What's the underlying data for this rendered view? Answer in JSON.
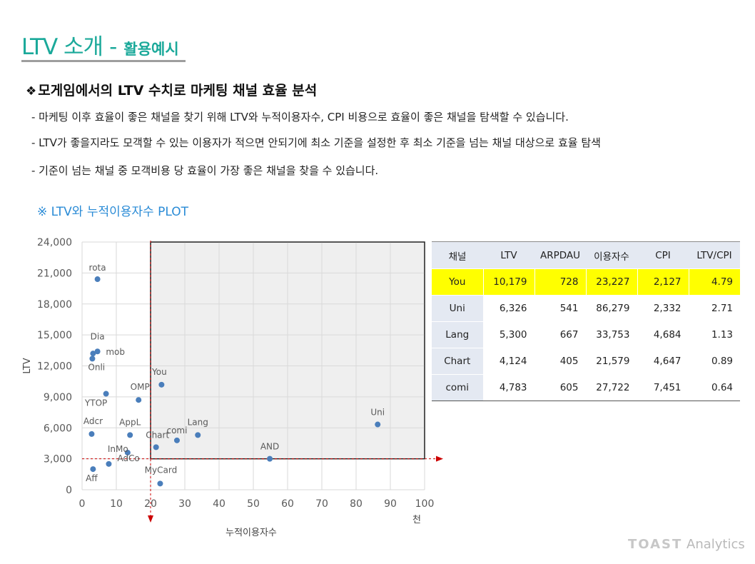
{
  "page": {
    "title_main": "LTV 소개",
    "title_dash": "-",
    "title_sub": "활용예시",
    "heading_icon": "diamond-bullet-icon",
    "heading_symbol": "❖",
    "heading": "모게임에서의 LTV 수치로 마케팅 채널 효율 분석",
    "bullets": [
      "- 마케팅 이후 효율이 좋은 채널을 찾기 위해 LTV와 누적이용자수, CPI 비용으로 효율이 좋은 채널을 탐색할 수 있습니다.",
      "- LTV가 좋을지라도 모객할 수 있는 이용자가 적으면 안되기에 최소 기준을 설정한 후 최소 기준을 넘는 채널 대상으로 효율 탐색",
      "- 기준이 넘는 채널 중 모객비용 당 효율이 가장 좋은 채널을 찾을 수 있습니다."
    ],
    "chart_title": "※ LTV와 누적이용자수 PLOT",
    "logo_toast": "TOAST",
    "logo_analytics": "Analytics"
  },
  "chart_data": {
    "type": "scatter",
    "title": "",
    "xlabel": "누적이용자수",
    "ylabel": "LTV",
    "x_unit_label": "천",
    "xlim": [
      0,
      100
    ],
    "ylim": [
      0,
      24000
    ],
    "xticks": [
      0,
      10,
      20,
      30,
      40,
      50,
      60,
      70,
      80,
      90,
      100
    ],
    "yticks": [
      "0",
      "3,000",
      "6,000",
      "9,000",
      "12,000",
      "15,000",
      "18,000",
      "21,000",
      "24,000"
    ],
    "ytick_values": [
      0,
      3000,
      6000,
      9000,
      12000,
      15000,
      18000,
      21000,
      24000
    ],
    "grid": true,
    "point_color": "#4a7ebb",
    "threshold_color": "#cc0000",
    "threshold_x": 20,
    "threshold_y": 3000,
    "highlight_region": {
      "x": [
        20,
        100
      ],
      "y": [
        3000,
        24000
      ],
      "fill": "#efefef"
    },
    "points": [
      {
        "label": "rota",
        "x": 4.5,
        "y": 20400
      },
      {
        "label": "Dia",
        "x": 4.5,
        "y": 13400
      },
      {
        "label": "mob",
        "x": 3.2,
        "y": 13200
      },
      {
        "label": "Onli",
        "x": 3.0,
        "y": 12700
      },
      {
        "label": "You",
        "x": 23.2,
        "y": 10179
      },
      {
        "label": "OMP",
        "x": 16.5,
        "y": 8700
      },
      {
        "label": "YTOP",
        "x": 7.0,
        "y": 9300
      },
      {
        "label": "Adcr",
        "x": 2.8,
        "y": 5400
      },
      {
        "label": "AppL",
        "x": 14.0,
        "y": 5300
      },
      {
        "label": "Chart",
        "x": 21.6,
        "y": 4124
      },
      {
        "label": "comi",
        "x": 27.7,
        "y": 4783
      },
      {
        "label": "Lang",
        "x": 33.8,
        "y": 5300
      },
      {
        "label": "Uni",
        "x": 86.3,
        "y": 6326
      },
      {
        "label": "AND",
        "x": 54.8,
        "y": 3000
      },
      {
        "label": "InMo",
        "x": 13.3,
        "y": 3600
      },
      {
        "label": "AdCo",
        "x": 7.8,
        "y": 2500
      },
      {
        "label": "Aff",
        "x": 3.2,
        "y": 2000
      },
      {
        "label": "MyCard",
        "x": 22.8,
        "y": 600
      }
    ]
  },
  "table": {
    "headers": [
      "채널",
      "LTV",
      "ARPDAU",
      "이용자수",
      "CPI",
      "LTV/CPI"
    ],
    "rows": [
      [
        "You",
        "10,179",
        "728",
        "23,227",
        "2,127",
        "4.79"
      ],
      [
        "Uni",
        "6,326",
        "541",
        "86,279",
        "2,332",
        "2.71"
      ],
      [
        "Lang",
        "5,300",
        "667",
        "33,753",
        "4,684",
        "1.13"
      ],
      [
        "Chart",
        "4,124",
        "405",
        "21,579",
        "4,647",
        "0.89"
      ],
      [
        "comi",
        "4,783",
        "605",
        "27,722",
        "7,451",
        "0.64"
      ]
    ],
    "highlight_color": "#ffff00"
  }
}
